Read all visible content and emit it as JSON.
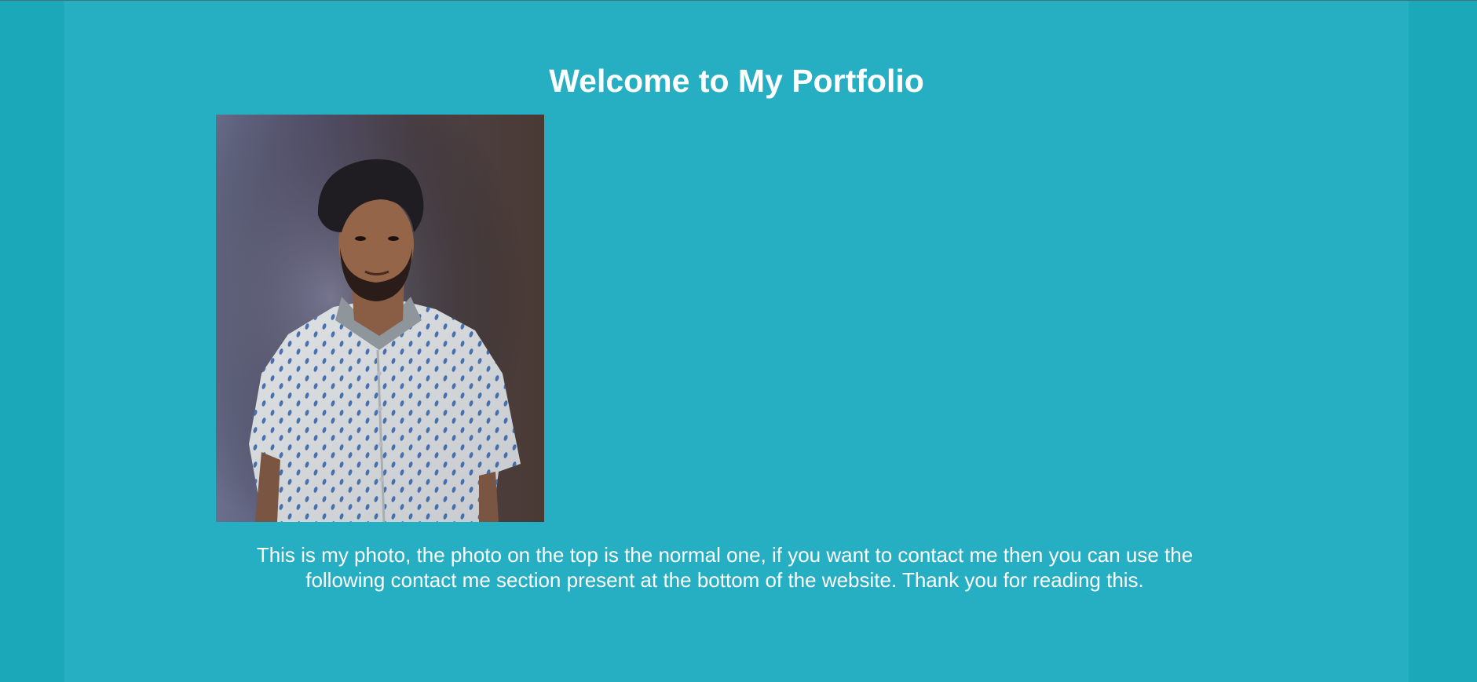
{
  "page": {
    "title": "Welcome to My Portfolio",
    "photo": {
      "icon": "profile-photo",
      "alt": "portrait photo"
    },
    "caption": "This is my photo, the photo on the top is the normal one, if you want to contact me then you can use the following contact me section present at the bottom of the website. Thank you for reading this."
  },
  "colors": {
    "background": "#1ba8b8",
    "container": "#26aec3",
    "text": "#ffffff"
  }
}
